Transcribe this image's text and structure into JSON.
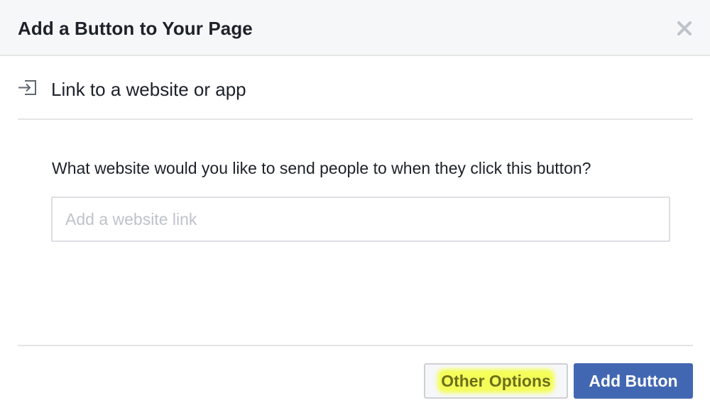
{
  "dialog": {
    "title": "Add a Button to Your Page",
    "close_icon": "close-icon"
  },
  "option": {
    "icon": "link-enter-icon",
    "label": "Link to a website or app"
  },
  "form": {
    "question": "What website would you like to send people to when they click this button?",
    "website_input": {
      "value": "",
      "placeholder": "Add a website link"
    }
  },
  "footer": {
    "other_options_label": "Other Options",
    "add_button_label": "Add Button"
  },
  "colors": {
    "primary": "#4267b2",
    "highlight": "#f4ff5a",
    "border": "#e5e5e5"
  }
}
